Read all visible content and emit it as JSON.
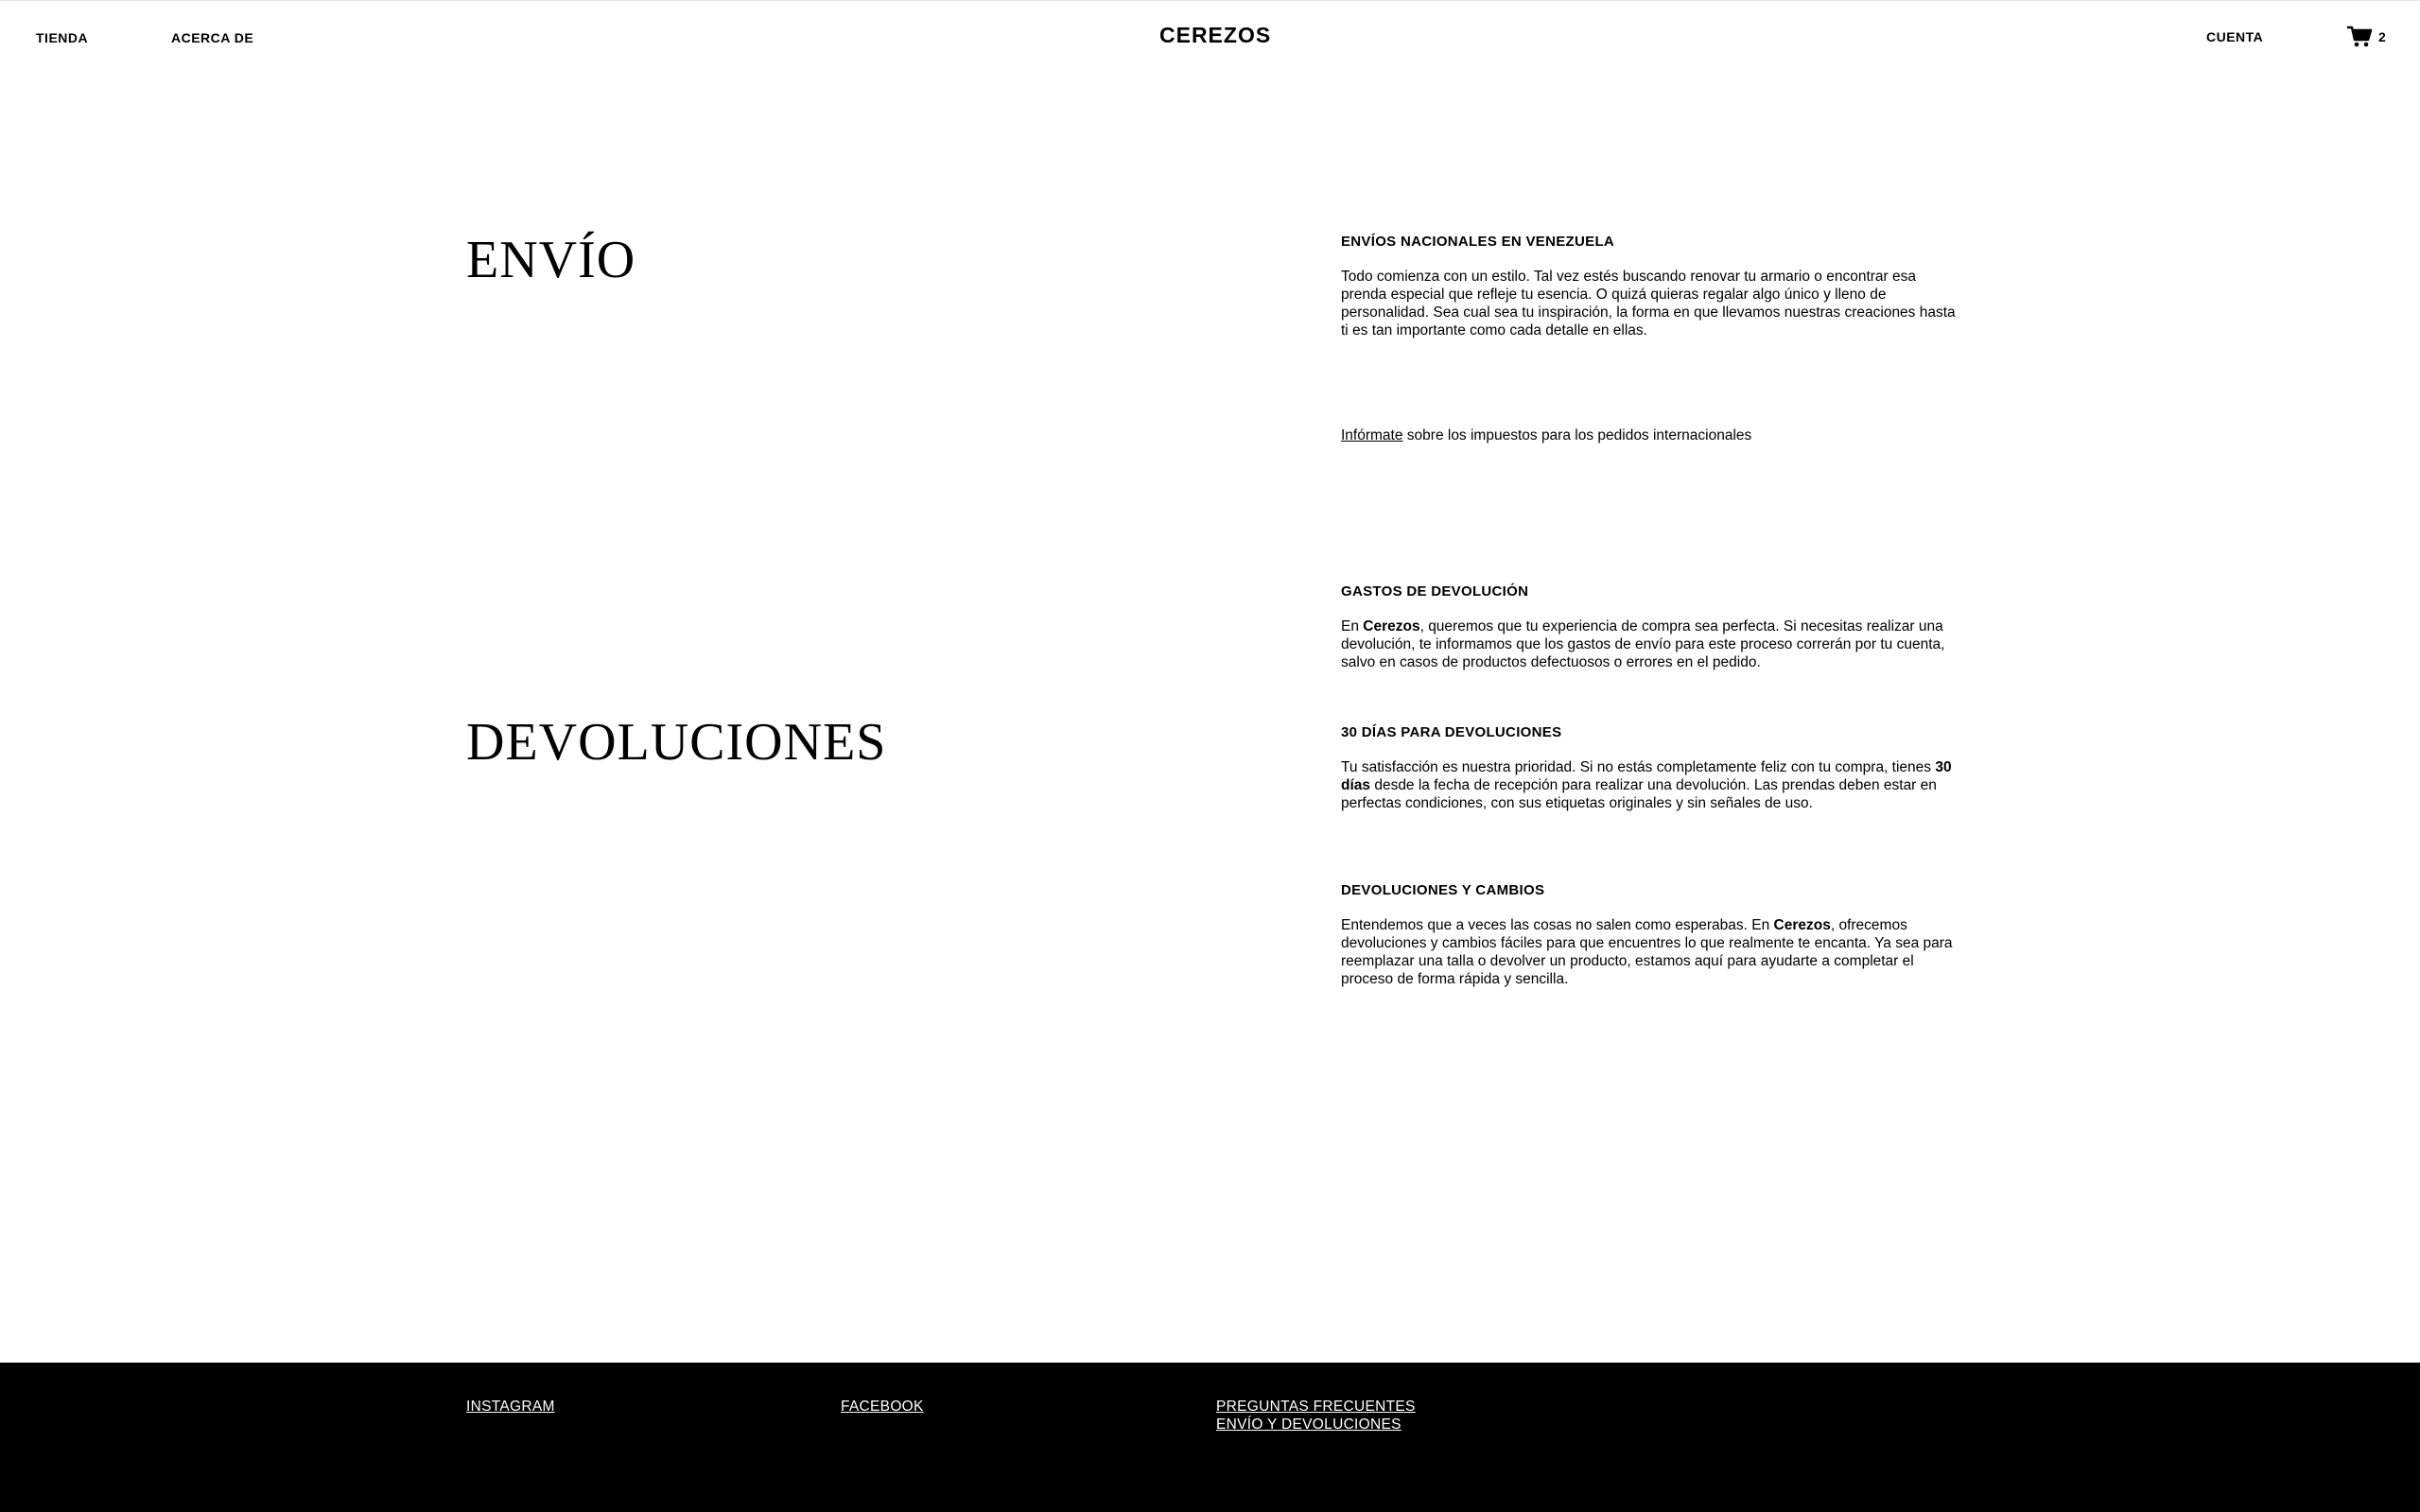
{
  "header": {
    "nav": [
      {
        "label": "TIENDA"
      },
      {
        "label": "ACERCA DE"
      }
    ],
    "brand": "CEREZOS",
    "account_label": "CUENTA",
    "cart_count": "2",
    "cart_icon": "shopping-cart-icon"
  },
  "shipping": {
    "title": "ENVÍO",
    "heading": "ENVÍOS NACIONALES EN VENEZUELA",
    "body": "Todo comienza con un estilo. Tal vez estés buscando renovar tu armario o encontrar esa prenda especial que refleje tu esencia. O quizá quieras regalar algo único y lleno de personalidad. Sea cual sea tu inspiración, la forma en que llevamos nuestras creaciones hasta ti es tan importante como cada detalle en ellas.",
    "info_link": "Infórmate",
    "info_text": " sobre los impuestos para los pedidos internacionales"
  },
  "returns": {
    "title": "DEVOLUCIONES",
    "costs_heading": "GASTOS DE DEVOLUCIÓN",
    "costs_prefix": "En ",
    "costs_brand": "Cerezos",
    "costs_body": ", queremos que tu experiencia de compra sea perfecta. Si necesitas realizar una devolución, te informamos que los gastos de envío para este proceso correrán por tu cuenta, salvo en casos de productos defectuosos o errores en el pedido.",
    "days_heading": "30 DÍAS PARA DEVOLUCIONES",
    "days_prefix": "Tu satisfacción es nuestra prioridad. Si no estás completamente feliz con tu compra, tienes ",
    "days_bold": "30 días",
    "days_suffix": " desde la fecha de recepción para realizar una devolución. Las prendas deben estar en perfectas condiciones, con sus etiquetas originales y sin señales de uso.",
    "exchange_heading": "DEVOLUCIONES Y CAMBIOS",
    "exchange_prefix": "Entendemos que a veces las cosas no salen como esperabas. En ",
    "exchange_brand": "Cerezos",
    "exchange_suffix": ", ofrecemos devoluciones y cambios fáciles para que encuentres lo que realmente te encanta. Ya sea para reemplazar una talla o devolver un producto, estamos aquí para ayudarte a completar el proceso de forma rápida y sencilla."
  },
  "footer": {
    "instagram": "INSTAGRAM",
    "facebook": "FACEBOOK",
    "faq": "PREGUNTAS FRECUENTES",
    "shipping_returns": "ENVÍO Y DEVOLUCIONES"
  },
  "colors": {
    "background": "#ffffff",
    "text": "#000000",
    "footer_background": "#000000",
    "footer_text": "#ffffff"
  }
}
